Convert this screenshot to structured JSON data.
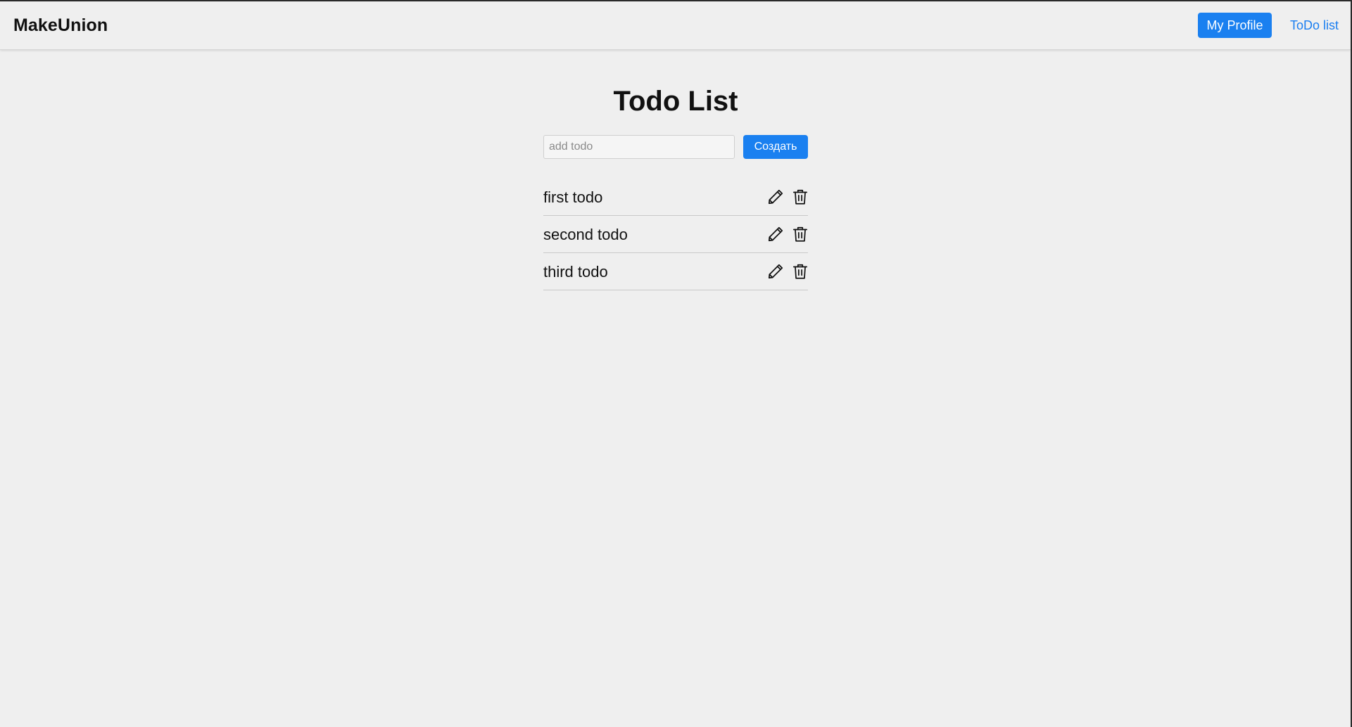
{
  "header": {
    "brand": "MakeUnion",
    "profile_button": "My Profile",
    "todo_link": "ToDo list"
  },
  "main": {
    "title": "Todo List",
    "input": {
      "placeholder": "add todo",
      "value": ""
    },
    "create_button": "Создать",
    "todos": [
      {
        "text": "first todo",
        "edit_icon": "pencil-icon",
        "delete_icon": "trash-icon"
      },
      {
        "text": "second todo",
        "edit_icon": "pencil-icon",
        "delete_icon": "trash-icon"
      },
      {
        "text": "third todo",
        "edit_icon": "pencil-icon",
        "delete_icon": "trash-icon"
      }
    ]
  },
  "colors": {
    "accent": "#1a80f0",
    "link": "#1a7ef0",
    "background": "#efefef",
    "text": "#111111",
    "divider": "#c9c9c9"
  }
}
